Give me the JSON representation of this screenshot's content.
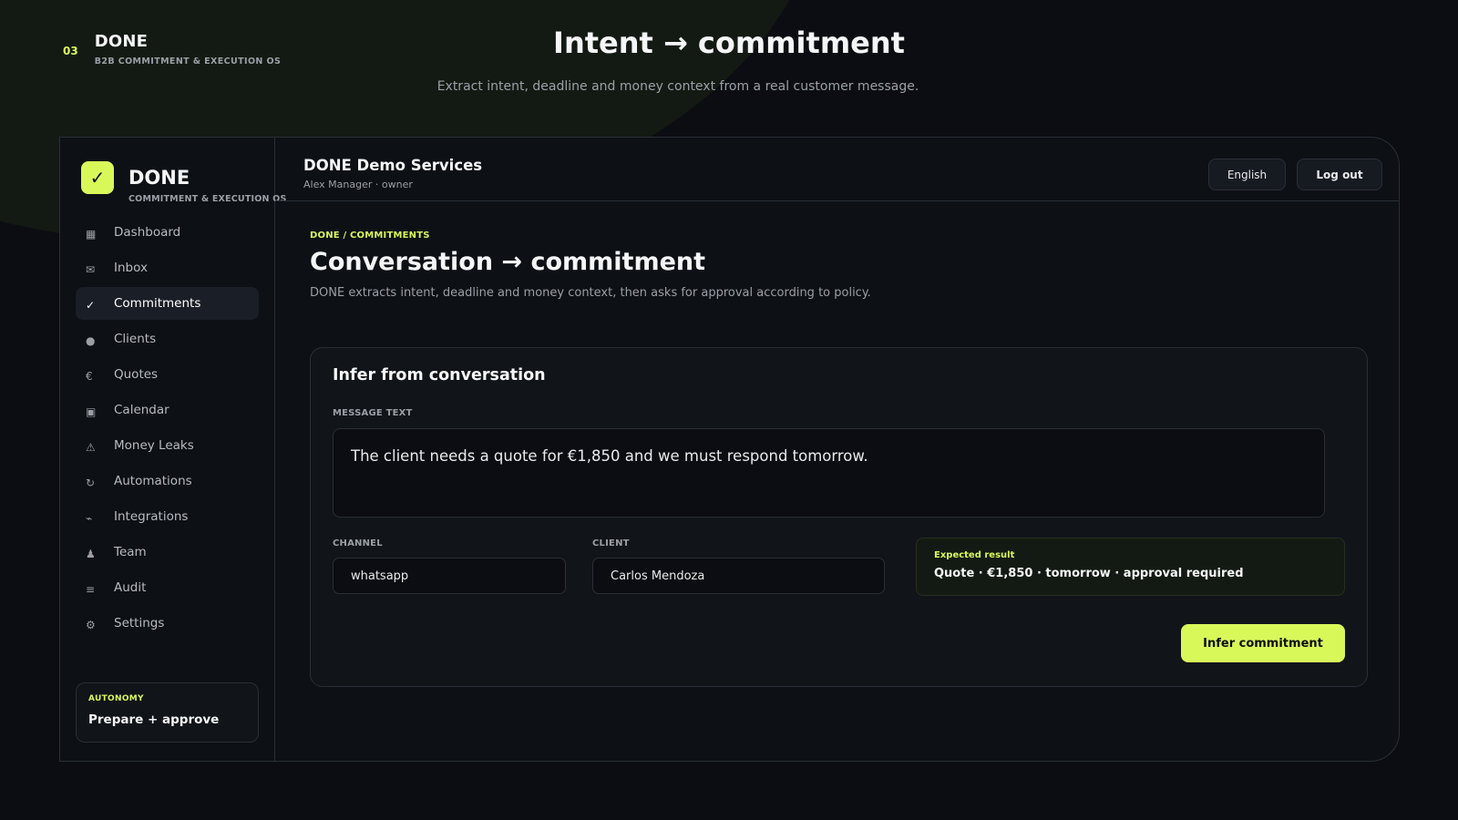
{
  "slide": {
    "number": "03",
    "brand": "DONE",
    "tagline": "B2B COMMITMENT & EXECUTION OS",
    "title": "Intent → commitment",
    "subtitle": "Extract intent, deadline and money context from a real customer message."
  },
  "sidebar": {
    "logo_glyph": "✓",
    "brand": "DONE",
    "tagline": "COMMITMENT & EXECUTION OS",
    "items": [
      {
        "label": "Dashboard",
        "icon": "▦",
        "active": false
      },
      {
        "label": "Inbox",
        "icon": "✉",
        "active": false
      },
      {
        "label": "Commitments",
        "icon": "✓",
        "active": true
      },
      {
        "label": "Clients",
        "icon": "●",
        "active": false
      },
      {
        "label": "Quotes",
        "icon": "€",
        "active": false
      },
      {
        "label": "Calendar",
        "icon": "▣",
        "active": false
      },
      {
        "label": "Money Leaks",
        "icon": "⚠",
        "active": false
      },
      {
        "label": "Automations",
        "icon": "↻",
        "active": false
      },
      {
        "label": "Integrations",
        "icon": "⌁",
        "active": false
      },
      {
        "label": "Team",
        "icon": "♟",
        "active": false
      },
      {
        "label": "Audit",
        "icon": "≡",
        "active": false
      },
      {
        "label": "Settings",
        "icon": "⚙",
        "active": false
      }
    ],
    "autonomy": {
      "label": "AUTONOMY",
      "value": "Prepare + approve"
    }
  },
  "header": {
    "org_name": "DONE Demo Services",
    "user": "Alex Manager · owner",
    "language_label": "English",
    "logout_label": "Log out"
  },
  "page": {
    "breadcrumb": "DONE / COMMITMENTS",
    "title": "Conversation → commitment",
    "description": "DONE extracts intent, deadline and money context, then asks for approval according to policy."
  },
  "infer_card": {
    "title": "Infer from conversation",
    "message_label": "MESSAGE TEXT",
    "message_value": "The client needs a quote for €1,850 and we must respond tomorrow.",
    "channel_label": "CHANNEL",
    "channel_value": "whatsapp",
    "client_label": "CLIENT",
    "client_value": "Carlos Mendoza",
    "expected_label": "Expected result",
    "expected_value": "Quote · €1,850 · tomorrow · approval required",
    "button_label": "Infer commitment"
  },
  "colors": {
    "accent": "#d8f85a",
    "background": "#0b0d12",
    "panel": "#111419",
    "border": "#2a2f37"
  }
}
